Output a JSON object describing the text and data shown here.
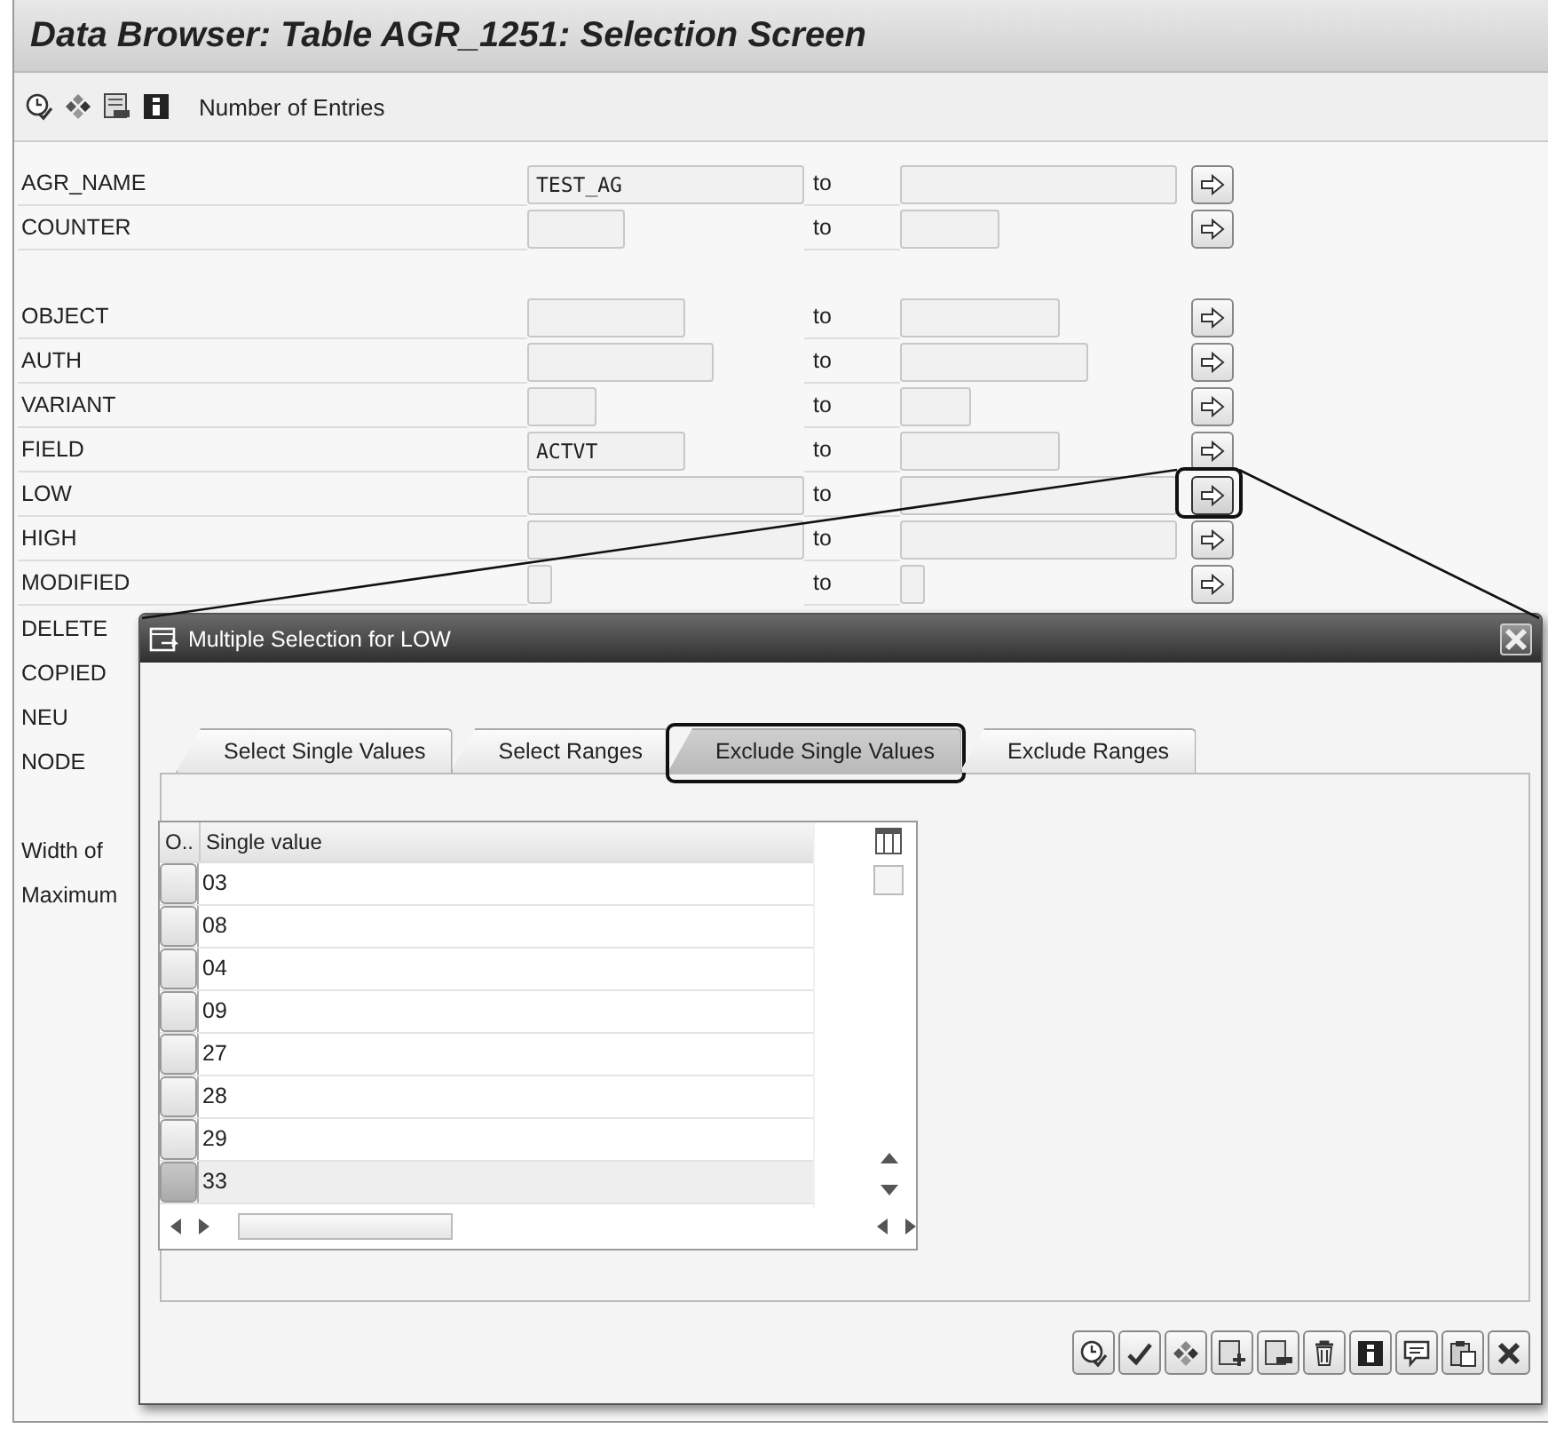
{
  "window": {
    "title": "Data Browser: Table AGR_1251: Selection Screen"
  },
  "toolbar": {
    "button": "Number of Entries"
  },
  "selection_groups": [
    [
      {
        "kind": "field",
        "label": "AGR_NAME",
        "value": "TEST_AG",
        "to": "to",
        "highlighted": false
      },
      {
        "kind": "field",
        "label": "COUNTER",
        "to": "to",
        "highlighted": false
      }
    ],
    [
      {
        "kind": "field",
        "label": "OBJECT",
        "to": "to",
        "highlighted": false
      },
      {
        "kind": "field",
        "label": "AUTH",
        "to": "to",
        "highlighted": false
      },
      {
        "kind": "field",
        "label": "VARIANT",
        "to": "to",
        "highlighted": false
      },
      {
        "kind": "field",
        "label": "FIELD",
        "value": "ACTVT",
        "to": "to",
        "highlighted": false
      },
      {
        "kind": "field",
        "label": "LOW",
        "to": "to",
        "highlighted": true
      },
      {
        "kind": "field",
        "label": "HIGH",
        "to": "to",
        "highlighted": false
      },
      {
        "kind": "field",
        "label": "MODIFIED",
        "to": "to",
        "highlighted": false
      },
      {
        "kind": "covered",
        "label": "DELETE"
      },
      {
        "kind": "covered",
        "label": "COPIED"
      },
      {
        "kind": "covered",
        "label": "NEU"
      },
      {
        "kind": "covered",
        "label": "NODE"
      }
    ],
    [
      {
        "kind": "covered",
        "label": "Width of"
      },
      {
        "kind": "covered",
        "label": "Maximum"
      }
    ]
  ],
  "dialog": {
    "title": "Multiple Selection for LOW",
    "tabs": [
      {
        "label": "Select Single Values",
        "selected": false,
        "highlighted": false
      },
      {
        "label": "Select Ranges",
        "selected": false,
        "highlighted": false
      },
      {
        "label": "Exclude Single Values",
        "selected": true,
        "highlighted": true
      },
      {
        "label": "Exclude Ranges",
        "selected": false,
        "highlighted": false
      }
    ],
    "table": {
      "columns": [
        "O..",
        "Single value"
      ],
      "rows": [
        {
          "value": "03",
          "selected": false
        },
        {
          "value": "08",
          "selected": false
        },
        {
          "value": "04",
          "selected": false
        },
        {
          "value": "09",
          "selected": false
        },
        {
          "value": "27",
          "selected": false
        },
        {
          "value": "28",
          "selected": false
        },
        {
          "value": "29",
          "selected": false
        },
        {
          "value": "33",
          "selected": true
        }
      ]
    }
  }
}
